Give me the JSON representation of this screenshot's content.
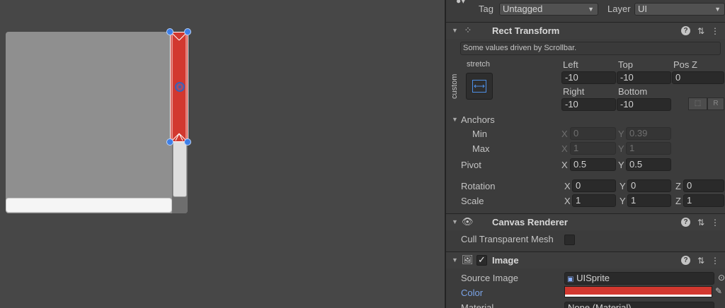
{
  "colors": {
    "accent_red": "#d2382f",
    "handle_blue": "#3e7fe6",
    "inspector_bg": "#3c3c3c",
    "scene_bg": "#474747"
  },
  "header": {
    "tag_label": "Tag",
    "tag_value": "Untagged",
    "layer_label": "Layer",
    "layer_value": "UI"
  },
  "rect_transform": {
    "title": "Rect Transform",
    "notice": "Some values driven by Scrollbar.",
    "anchor_preset_top": "stretch",
    "anchor_preset_side": "custom",
    "left_label": "Left",
    "left_value": "-10",
    "top_label": "Top",
    "top_value": "-10",
    "posz_label": "Pos Z",
    "posz_value": "0",
    "right_label": "Right",
    "right_value": "-10",
    "bottom_label": "Bottom",
    "bottom_value": "-10",
    "raw_button": "R",
    "anchors_label": "Anchors",
    "min_label": "Min",
    "min_x": "0",
    "min_y": "0.39",
    "max_label": "Max",
    "max_x": "1",
    "max_y": "1",
    "pivot_label": "Pivot",
    "pivot_x": "0.5",
    "pivot_y": "0.5",
    "rotation_label": "Rotation",
    "rot_x": "0",
    "rot_y": "0",
    "rot_z": "0",
    "scale_label": "Scale",
    "scale_x": "1",
    "scale_y": "1",
    "scale_z": "1",
    "axis_x": "X",
    "axis_y": "Y",
    "axis_z": "Z"
  },
  "canvas_renderer": {
    "title": "Canvas Renderer",
    "cull_label": "Cull Transparent Mesh",
    "cull_checked": false
  },
  "image": {
    "title": "Image",
    "enabled": true,
    "source_label": "Source Image",
    "source_value": "UISprite",
    "color_label": "Color",
    "color_value": "#d2382f",
    "material_label": "Material",
    "material_value": "None (Material)"
  }
}
